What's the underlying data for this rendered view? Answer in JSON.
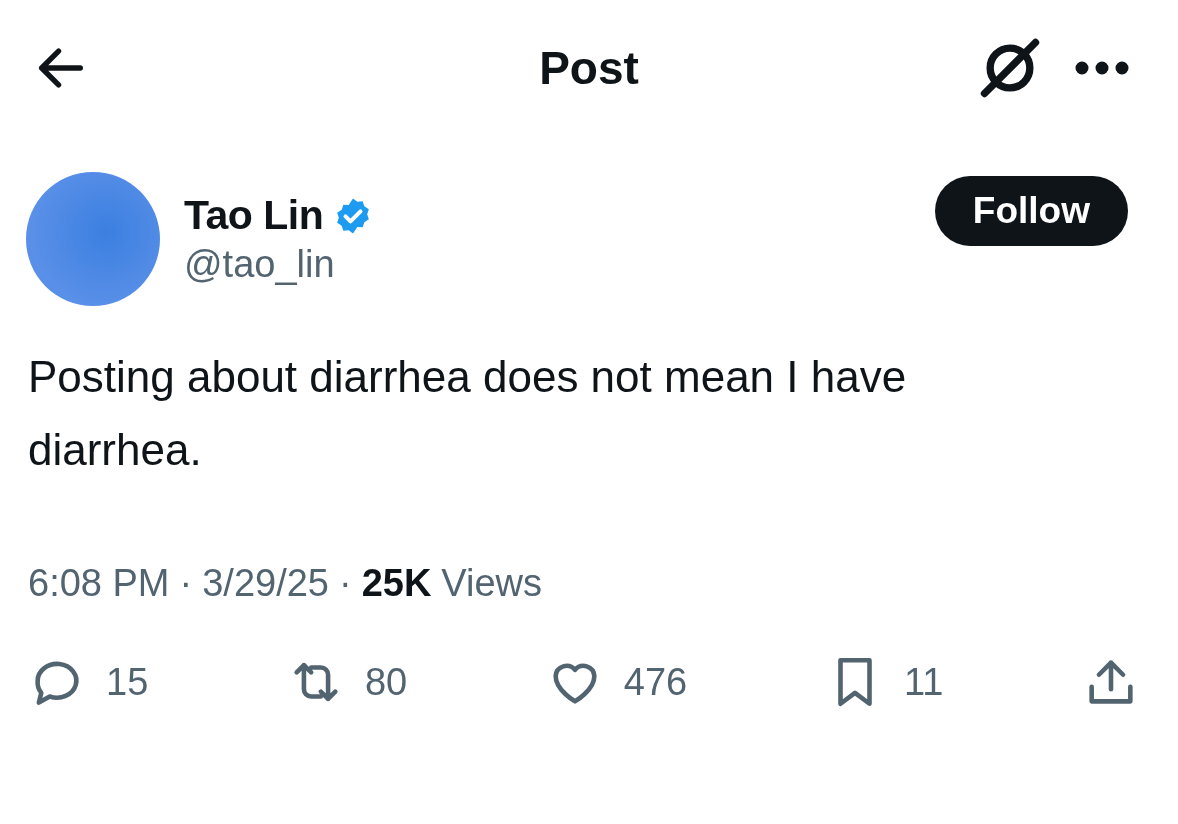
{
  "header": {
    "title": "Post"
  },
  "author": {
    "name": "Tao Lin",
    "verified": true,
    "handle": "@tao_lin"
  },
  "follow_button": {
    "label": "Follow"
  },
  "post": {
    "text": "Posting about diarrhea does not mean I have diarrhea."
  },
  "meta": [
    {
      "kind": "text",
      "text": "6:08 PM"
    },
    {
      "kind": "separator",
      "text": "·"
    },
    {
      "kind": "text",
      "text": "3/29/25"
    },
    {
      "kind": "separator",
      "text": "·"
    },
    {
      "kind": "strong",
      "text": "25K"
    },
    {
      "kind": "text",
      "text": "Views"
    }
  ],
  "actions": [
    {
      "kind": "reply",
      "count": "15"
    },
    {
      "kind": "repost",
      "count": "80"
    },
    {
      "kind": "like",
      "count": "476"
    },
    {
      "kind": "bookmark",
      "count": "11"
    },
    {
      "kind": "share"
    }
  ]
}
